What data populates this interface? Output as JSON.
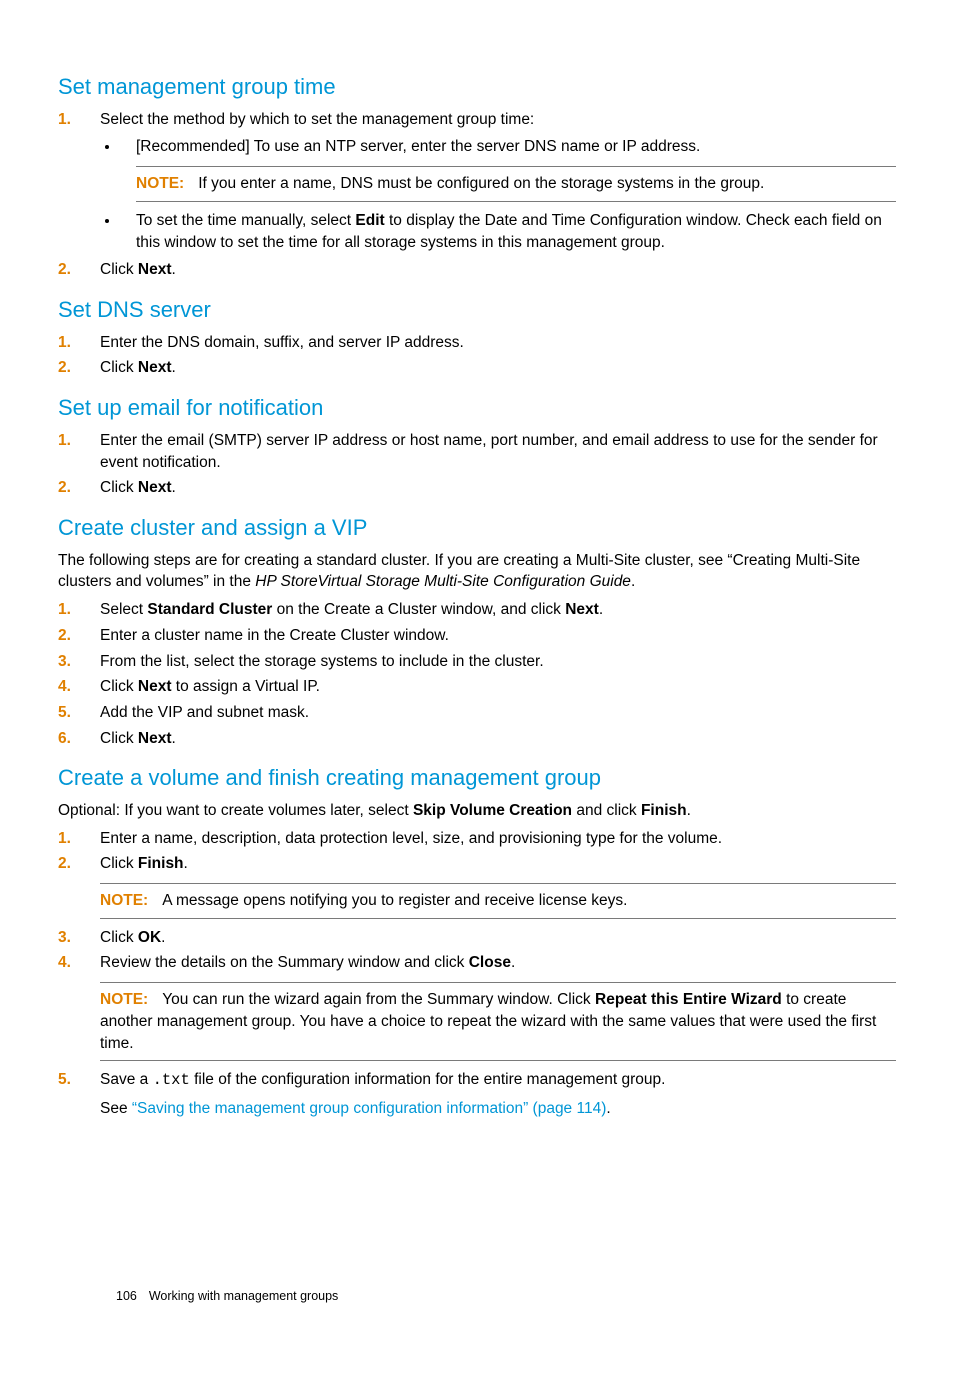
{
  "sections": [
    {
      "heading": "Set management group time",
      "items": [
        {
          "num": "1.",
          "text": "Select the method by which to set the management group time:",
          "bullets": [
            {
              "text": "[Recommended] To use an NTP server, enter the server DNS name or IP address.",
              "note": {
                "label": "NOTE:",
                "text": "If you enter a name, DNS must be configured on the storage systems in the group."
              }
            },
            {
              "prefix": "To set the time manually, select ",
              "bold1": "Edit",
              "suffix": " to display the Date and Time Configuration window. Check each field on this window to set the time for all storage systems in this management group."
            }
          ]
        },
        {
          "num": "2.",
          "prefix": "Click ",
          "bold": "Next",
          "suffix": "."
        }
      ]
    },
    {
      "heading": "Set DNS server",
      "items": [
        {
          "num": "1.",
          "text": "Enter the DNS domain, suffix, and server IP address."
        },
        {
          "num": "2.",
          "prefix": "Click ",
          "bold": "Next",
          "suffix": "."
        }
      ]
    },
    {
      "heading": "Set up email for notification",
      "items": [
        {
          "num": "1.",
          "text": "Enter the email (SMTP) server IP address or host name, port number, and email address to use for the sender for event notification."
        },
        {
          "num": "2.",
          "prefix": "Click ",
          "bold": "Next",
          "suffix": "."
        }
      ]
    }
  ],
  "cluster": {
    "heading": "Create cluster and assign a VIP",
    "intro_pre": "The following steps are for creating a standard cluster. If you are creating a Multi-Site cluster, see “Creating Multi-Site clusters and volumes” in the ",
    "intro_em": "HP StoreVirtual Storage Multi-Site Configuration Guide",
    "intro_post": ".",
    "items": [
      {
        "num": "1.",
        "p1": "Select ",
        "b1": "Standard Cluster",
        "p2": " on the Create a Cluster window, and click ",
        "b2": "Next",
        "p3": "."
      },
      {
        "num": "2.",
        "text": "Enter a cluster name in the Create Cluster window."
      },
      {
        "num": "3.",
        "text": "From the list, select the storage systems to include in the cluster."
      },
      {
        "num": "4.",
        "p1": "Click ",
        "b1": "Next",
        "p2": " to assign a Virtual IP."
      },
      {
        "num": "5.",
        "text": "Add the VIP and subnet mask."
      },
      {
        "num": "6.",
        "p1": "Click ",
        "b1": "Next",
        "p2": "."
      }
    ]
  },
  "volume": {
    "heading": "Create a volume and finish creating management group",
    "intro_p1": "Optional: If you want to create volumes later, select ",
    "intro_b1": "Skip Volume Creation",
    "intro_p2": " and click ",
    "intro_b2": "Finish",
    "intro_p3": ".",
    "items": {
      "s1": {
        "num": "1.",
        "text": "Enter a name, description, data protection level, size, and provisioning type for the volume."
      },
      "s2": {
        "num": "2.",
        "p1": "Click ",
        "b1": "Finish",
        "p2": ".",
        "note": {
          "label": "NOTE:",
          "text": "A message opens notifying you to register and receive license keys."
        }
      },
      "s3": {
        "num": "3.",
        "p1": "Click ",
        "b1": "OK",
        "p2": "."
      },
      "s4": {
        "num": "4.",
        "p1": "Review the details on the Summary window and click ",
        "b1": "Close",
        "p2": ".",
        "note": {
          "label": "NOTE:",
          "p1": "You can run the wizard again from the Summary window. Click ",
          "b1": "Repeat this Entire Wizard",
          "p2": " to create another management group. You have a choice to repeat the wizard with the same values that were used the first time."
        }
      },
      "s5": {
        "num": "5.",
        "p1": "Save a ",
        "mono": ".txt",
        "p2": " file of the configuration information for the entire management group.",
        "link_pre": "See ",
        "link_text": "“Saving the management group configuration information” (page 114)",
        "link_post": "."
      }
    }
  },
  "footer": {
    "pagenum": "106",
    "section": "Working with management groups"
  }
}
